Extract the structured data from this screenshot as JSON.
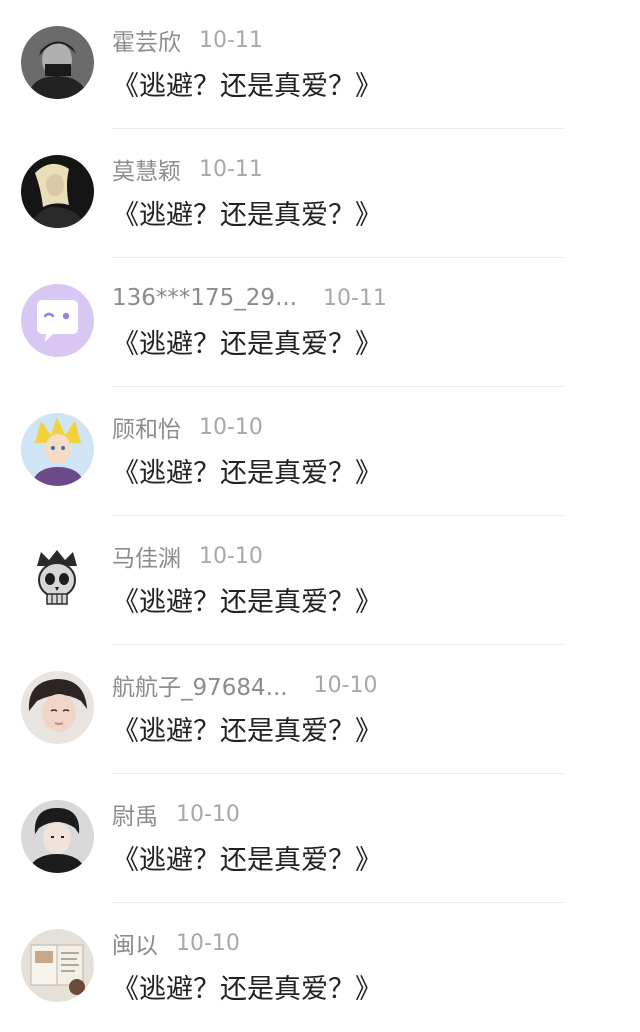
{
  "comments": [
    {
      "user": "霍芸欣",
      "date": "10-11",
      "text": "《逃避？还是真爱？》",
      "avatar": "dark-hooded-figure-avatar"
    },
    {
      "user": "莫慧颖",
      "date": "10-11",
      "text": "《逃避？还是真爱？》",
      "avatar": "blonde-person-avatar"
    },
    {
      "user": "136***175_29...",
      "date": "10-11",
      "text": "《逃避？还是真爱？》",
      "avatar": "default-chat-bubble-avatar"
    },
    {
      "user": "顾和怡",
      "date": "10-10",
      "text": "《逃避？还是真爱？》",
      "avatar": "anime-character-avatar"
    },
    {
      "user": "马佳渊",
      "date": "10-10",
      "text": "《逃避？还是真爱？》",
      "avatar": "crowned-skull-avatar"
    },
    {
      "user": "航航子_97684...",
      "date": "10-10",
      "text": "《逃避？还是真爱？》",
      "avatar": "person-portrait-avatar"
    },
    {
      "user": "尉禹",
      "date": "10-10",
      "text": "《逃避？还是真爱？》",
      "avatar": "short-hair-person-avatar"
    },
    {
      "user": "闽以",
      "date": "10-10",
      "text": "《逃避？还是真爱？》",
      "avatar": "book-photo-avatar"
    }
  ],
  "colors": {
    "username": "#8c8c8c",
    "date": "#a8a8a8",
    "comment": "#222222",
    "default_avatar_bg": "#d8c6f3"
  }
}
